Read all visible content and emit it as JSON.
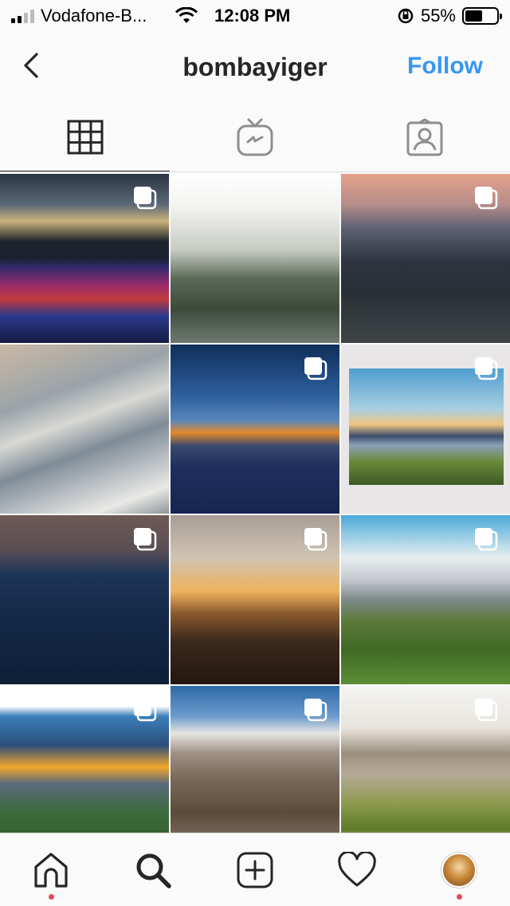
{
  "status_bar": {
    "carrier": "Vodafone-B...",
    "time": "12:08 PM",
    "battery_percent": "55%",
    "battery_level": 0.55
  },
  "nav": {
    "title": "bombayiger",
    "follow_label": "Follow",
    "accent_color": "#3897f0"
  },
  "tabs": [
    {
      "icon": "grid-icon",
      "active": true
    },
    {
      "icon": "igtv-icon",
      "active": false
    },
    {
      "icon": "tagged-icon",
      "active": false
    }
  ],
  "posts": [
    {
      "subject": "sunset-sky",
      "multi": true
    },
    {
      "subject": "misty-forest",
      "multi": false
    },
    {
      "subject": "lake-at-dusk",
      "multi": true
    },
    {
      "subject": "clouds-and-roof",
      "multi": false
    },
    {
      "subject": "sunset-above-clouds",
      "multi": true
    },
    {
      "subject": "valley-panorama",
      "multi": true
    },
    {
      "subject": "mountain-gazebo",
      "multi": true
    },
    {
      "subject": "cricket-silhouettes",
      "multi": true
    },
    {
      "subject": "green-valley-mountains",
      "multi": true
    },
    {
      "subject": "hill-sunset",
      "multi": true
    },
    {
      "subject": "town-valley",
      "multi": true
    },
    {
      "subject": "rainbow-valley",
      "multi": true
    }
  ],
  "bottom_bar": [
    {
      "icon": "home-icon",
      "notification": true
    },
    {
      "icon": "search-icon",
      "notification": false
    },
    {
      "icon": "new-post-icon",
      "notification": false
    },
    {
      "icon": "heart-icon",
      "notification": false
    },
    {
      "icon": "profile-avatar",
      "notification": true
    }
  ]
}
